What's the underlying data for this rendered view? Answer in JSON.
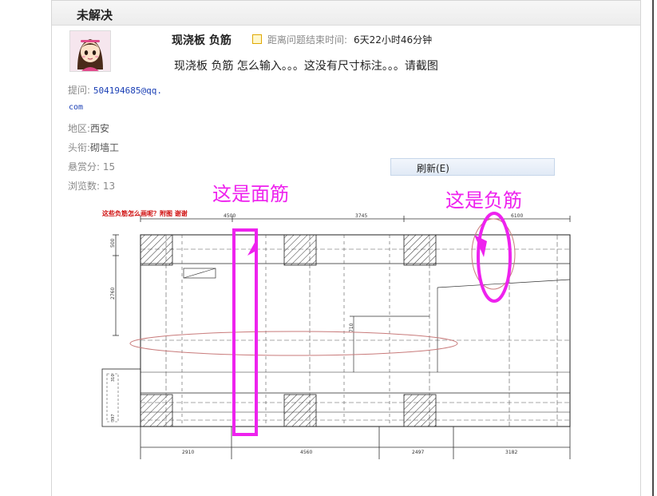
{
  "status": {
    "title": "未解决"
  },
  "question": {
    "title": "现浇板 负筋",
    "remaining_label": "距离问题结束时间:",
    "remaining_value": "6天22小时46分钟",
    "body": "现浇板 负筋 怎么输入。。。这没有尺寸标注。。。请截图"
  },
  "meta": {
    "asker_label": "提问:",
    "asker_value": "504194685@qq.",
    "asker_value_cont": "com",
    "region_label": "地区:",
    "region_value": "西安",
    "rank_label": "头衔:",
    "rank_value": "砌墙工",
    "reward_label": "悬赏分:",
    "reward_value": "15",
    "views_label": "浏览数:",
    "views_value": "13"
  },
  "context_menu": {
    "refresh_label": "刷新(E)"
  },
  "drawing": {
    "annotation_face": "这是面筋",
    "annotation_neg": "这是负筋",
    "caption": "这些负筋怎么画呢？附图 谢谢",
    "dims_top": [
      "4500",
      "3745",
      "6100"
    ],
    "dims_bottom": [
      "2910",
      "4560",
      "2497",
      "3182"
    ],
    "dims_left": [
      "500",
      "2760"
    ],
    "dim_mid": "710",
    "dims_small": [
      "310",
      "397"
    ],
    "colors": {
      "magenta": "#ee22ee",
      "ellipse": "#c87a7a",
      "caption": "#d01010"
    }
  }
}
